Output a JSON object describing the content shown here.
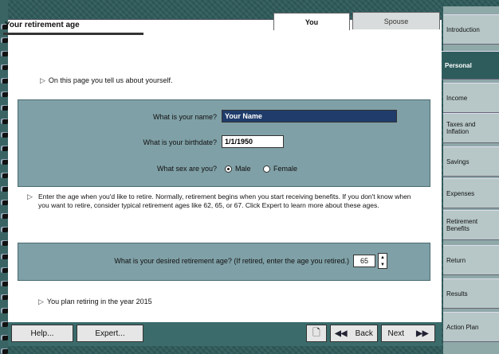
{
  "tabs": {
    "you": "You",
    "spouse": "Spouse"
  },
  "page": {
    "heading": "Your retirement age",
    "intro": "On this page you tell us about yourself."
  },
  "form": {
    "name_label": "What is your name?",
    "name_value": "Your Name",
    "dob_label": "What is your birthdate?",
    "dob_value": "1/1/1950",
    "sex_label": "What sex are you?",
    "male": "Male",
    "female": "Female",
    "selected_sex": "Male"
  },
  "instructions": "Enter the age when you'd like to retire. Normally, retirement begins when you start receiving benefits. If you don't know when you want to retire, consider typical retirement ages like 62, 65, or 67. Click Expert to learn more about these ages.",
  "retire": {
    "label": "What is your desired retirement age? (If retired, enter the age you retired.)",
    "value": "65"
  },
  "footer_note": "You plan retiring in the year 2015",
  "toolbar": {
    "help": "Help...",
    "expert": "Expert...",
    "back": "Back",
    "next": "Next"
  },
  "nav": [
    {
      "label": "Introduction"
    },
    {
      "label": "Personal"
    },
    {
      "label": "Income"
    },
    {
      "label": "Taxes and Inflation"
    },
    {
      "label": "Savings"
    },
    {
      "label": "Expenses"
    },
    {
      "label": "Retirement Benefits"
    },
    {
      "label": "Return"
    },
    {
      "label": "Results"
    },
    {
      "label": "Action Plan"
    }
  ],
  "colors": {
    "panel": "#7fa0a6",
    "frame": "#2f5a5a",
    "active_nav": "#2e5c5c"
  }
}
